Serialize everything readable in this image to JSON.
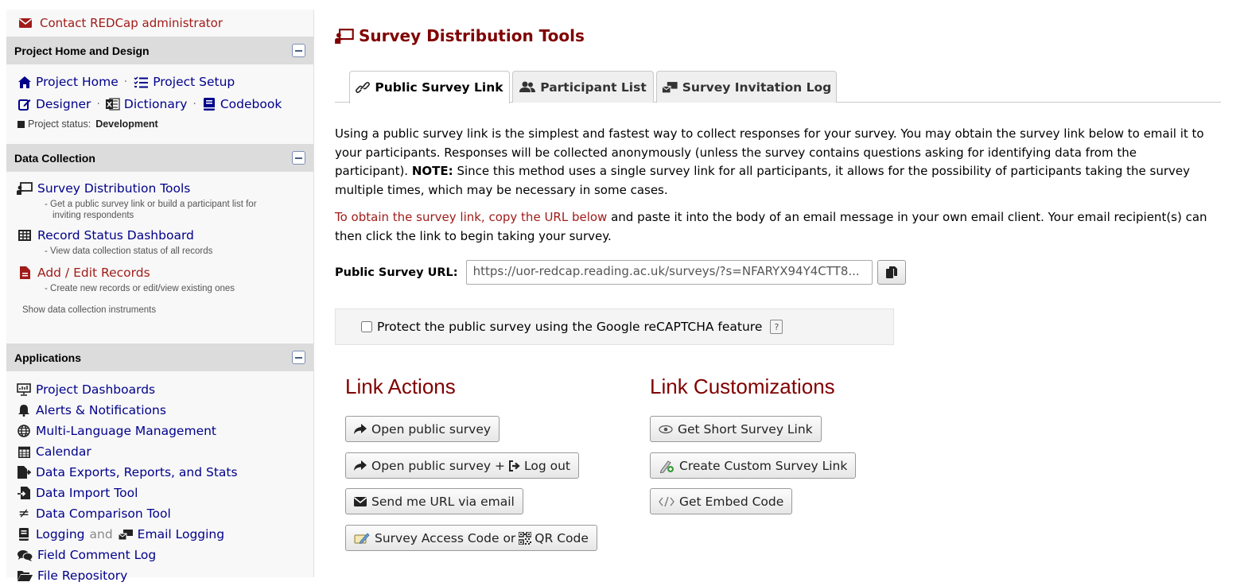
{
  "sidebar": {
    "contact_label": "Contact REDCap administrator",
    "sections": {
      "home": {
        "title": "Project Home and Design",
        "project_home": "Project Home",
        "project_setup": "Project Setup",
        "designer": "Designer",
        "dictionary": "Dictionary",
        "codebook": "Codebook",
        "status_label": "Project status:",
        "status_value": "Development",
        "separator": "·"
      },
      "data_collection": {
        "title": "Data Collection",
        "survey_tools": "Survey Distribution Tools",
        "survey_tools_desc_1": "- Get a public survey link or build a participant list for",
        "survey_tools_desc_2": "inviting respondents",
        "record_status": "Record Status Dashboard",
        "record_status_desc": "- View data collection status of all records",
        "add_edit": "Add / Edit Records",
        "add_edit_desc": "- Create new records or edit/view existing ones",
        "show_instruments": "Show data collection instruments"
      },
      "applications": {
        "title": "Applications",
        "items": [
          "Project Dashboards",
          "Alerts & Notifications",
          "Multi-Language Management",
          "Calendar",
          "Data Exports, Reports, and Stats",
          "Data Import Tool",
          "Data Comparison Tool",
          "Logging",
          "Field Comment Log",
          "File Repository"
        ],
        "logging_and": "and",
        "email_logging": "Email Logging"
      }
    }
  },
  "main": {
    "title": "Survey Distribution Tools",
    "tabs": [
      "Public Survey Link",
      "Participant List",
      "Survey Invitation Log"
    ],
    "para1_a": "Using a public survey link is the simplest and fastest way to collect responses for your survey. You may obtain the survey link below to email it to your participants. Responses will be collected anonymously (unless the survey contains questions asking for identifying data from the participant).",
    "para1_note": "NOTE:",
    "para1_b": "Since this method uses a single survey link for all participants, it allows for the possibility of participants taking the survey multiple times, which may be necessary in some cases.",
    "para2_red": "To obtain the survey link, copy the URL below",
    "para2_rest": "and paste it into the body of an email message in your own email client. Your email recipient(s) can then click the link to begin taking your survey.",
    "url_label": "Public Survey URL:",
    "url_value": "https://uor-redcap.reading.ac.uk/surveys/?s=NFARYX94Y4CTT8...",
    "captcha_label": "Protect the public survey using the Google reCAPTCHA feature",
    "captcha_help": "?",
    "link_actions": {
      "title": "Link Actions",
      "open_survey": "Open public survey",
      "open_survey_logout_a": "Open public survey +",
      "open_survey_logout_b": "Log out",
      "send_email": "Send me URL via email",
      "access_code_a": "Survey Access Code or",
      "access_code_b": "QR Code"
    },
    "link_custom": {
      "title": "Link Customizations",
      "short_link": "Get Short Survey Link",
      "custom_link": "Create Custom Survey Link",
      "embed_code": "Get Embed Code"
    }
  }
}
